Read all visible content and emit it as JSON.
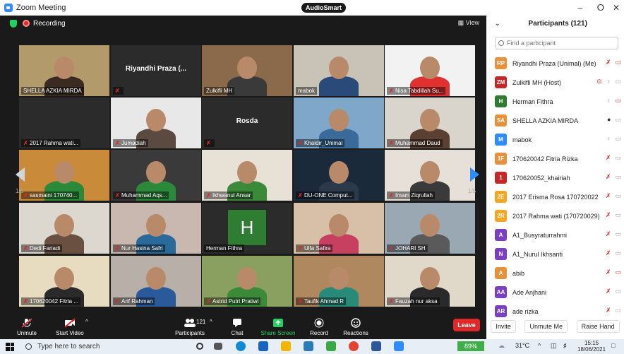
{
  "window": {
    "title": "Zoom Meeting",
    "brand": "AudioSmart",
    "minimize": "–",
    "maximize": "ⵔ",
    "close": "✕"
  },
  "meeting": {
    "recording_label": "Recording",
    "view_label": "View",
    "page_left": "1/5",
    "page_right": "1/5"
  },
  "tiles": [
    {
      "name": "SHELLA AZKIA MIRDA",
      "muted": false,
      "active": true,
      "kind": "video",
      "colors": [
        "#b29a6a",
        "#3a2a22"
      ]
    },
    {
      "name": "",
      "big": "Riyandhi Praza (...",
      "muted": true,
      "kind": "none"
    },
    {
      "name": "Zulkifli MH",
      "muted": false,
      "kind": "video",
      "colors": [
        "#8a6a4a",
        "#3a3a3a"
      ]
    },
    {
      "name": "mabok",
      "muted": false,
      "kind": "video",
      "colors": [
        "#c9c2b6",
        "#2a4a7a"
      ]
    },
    {
      "name": "Nisa Tabdillah Su...",
      "muted": true,
      "kind": "video",
      "colors": [
        "#f2f2f2",
        "#e03030"
      ]
    },
    {
      "name": "2017 Rahma wati...",
      "muted": true,
      "kind": "none"
    },
    {
      "name": "Jumadiah",
      "muted": true,
      "kind": "video",
      "colors": [
        "#e8e8e8",
        "#5a4a40"
      ]
    },
    {
      "name": "",
      "big": "Rosda",
      "muted": true,
      "kind": "none"
    },
    {
      "name": "Khaidir_Unimal",
      "muted": true,
      "kind": "video",
      "colors": [
        "#7fa7c9",
        "#3a6a9a"
      ]
    },
    {
      "name": "Muhammad Daud",
      "muted": true,
      "kind": "video",
      "colors": [
        "#d9d4cc",
        "#5a4030"
      ]
    },
    {
      "name": "sasmaini 170740...",
      "muted": true,
      "kind": "video",
      "colors": [
        "#c98a3a",
        "#2a8a3a"
      ]
    },
    {
      "name": "Muhammad Aqs...",
      "muted": true,
      "kind": "video",
      "colors": [
        "#3a3a3a",
        "#2a8a3a"
      ]
    },
    {
      "name": "Ikhwanul Ansar",
      "muted": true,
      "kind": "video",
      "colors": [
        "#e8e2d6",
        "#3a8a3a"
      ]
    },
    {
      "name": "DU-ONE Comput...",
      "muted": true,
      "kind": "video",
      "colors": [
        "#1a2a3a",
        "#2a3a4a"
      ]
    },
    {
      "name": "Imam Ziqrullah",
      "muted": true,
      "kind": "video",
      "colors": [
        "#e6e0d8",
        "#3a3a3a"
      ]
    },
    {
      "name": "Dedi Fariadi",
      "muted": true,
      "kind": "video",
      "colors": [
        "#dcd8d0",
        "#6a5040"
      ]
    },
    {
      "name": "Nur Hasina Safri",
      "muted": true,
      "kind": "video",
      "colors": [
        "#c8b8b0",
        "#2a6a9a"
      ]
    },
    {
      "name": "Herman Fithra",
      "muted": false,
      "kind": "avatar",
      "letter": "H"
    },
    {
      "name": "Ulfa Safira",
      "muted": true,
      "kind": "video",
      "colors": [
        "#d8c0a8",
        "#c84060"
      ]
    },
    {
      "name": "JOHARI SH",
      "muted": true,
      "kind": "video",
      "colors": [
        "#9aa8b4",
        "#5a5a5a"
      ]
    },
    {
      "name": "170620042 Fitria ...",
      "muted": true,
      "kind": "video",
      "colors": [
        "#e8dcc0",
        "#2a2a2a"
      ]
    },
    {
      "name": "Arif Rahman",
      "muted": true,
      "kind": "video",
      "colors": [
        "#b8b0a8",
        "#2a5a9a"
      ]
    },
    {
      "name": "Astrid Putri Pratiwi",
      "muted": true,
      "kind": "video",
      "colors": [
        "#8aa060",
        "#3a8a3a"
      ]
    },
    {
      "name": "Taufik Ahmad R",
      "muted": true,
      "kind": "video",
      "colors": [
        "#b08860",
        "#2a8a7a"
      ]
    },
    {
      "name": "Fauzah nur aksa",
      "muted": true,
      "kind": "video",
      "colors": [
        "#e0d8c8",
        "#2a2a2a"
      ]
    }
  ],
  "toolbar": {
    "unmute": "Unmute",
    "start_video": "Start Video",
    "participants": "Participants",
    "participants_count": "121",
    "chat": "Chat",
    "share_screen": "Share Screen",
    "record": "Record",
    "reactions": "Reactions",
    "leave": "Leave",
    "colors": {
      "share": "#23d160",
      "leave": "#e02828"
    }
  },
  "panel": {
    "title": "Participants (121)",
    "search_placeholder": "Find a participant",
    "participants": [
      {
        "initials": "RP",
        "color": "#e8913a",
        "name": "Riyandhi Praza (Unimal) (Me)",
        "icons": "mic-off vid-off"
      },
      {
        "initials": "ZM",
        "color": "#c62828",
        "name": "Zulkifli MH (Host)",
        "icons": "share mic vid"
      },
      {
        "initials": "H",
        "color": "#2e7d32",
        "name": "Herman Fithra",
        "icons": "mic vid-off"
      },
      {
        "initials": "SA",
        "color": "#e8913a",
        "name": "SHELLA AZKIA MIRDA",
        "icons": "mic-on vid"
      },
      {
        "initials": "M",
        "color": "#2d8cff",
        "name": "mabok",
        "icons": "mic vid"
      },
      {
        "initials": "1F",
        "color": "#e8913a",
        "name": "170620042 Fitria Rizka",
        "icons": "mic-off vid"
      },
      {
        "initials": "1",
        "color": "#c62828",
        "name": "170620052_khairiah",
        "icons": "mic-off vid"
      },
      {
        "initials": "2E",
        "color": "#f5a623",
        "name": "2017 Erisma Rosa 170720022",
        "icons": "mic-off vid"
      },
      {
        "initials": "2R",
        "color": "#f5a623",
        "name": "2017 Rahma wati (170720029)",
        "icons": "mic-off vid"
      },
      {
        "initials": "A",
        "color": "#7b3fc4",
        "name": "A1_Busyraturrahmi",
        "icons": "mic-off vid"
      },
      {
        "initials": "N",
        "color": "#7b3fc4",
        "name": "A1_Nurul Ikhsanti",
        "icons": "mic-off vid"
      },
      {
        "initials": "A",
        "color": "#e8913a",
        "name": "abib",
        "icons": "mic-off vid-off"
      },
      {
        "initials": "AA",
        "color": "#7b3fc4",
        "name": "Ade Anjhani",
        "icons": "mic-off vid"
      },
      {
        "initials": "AR",
        "color": "#7b3fc4",
        "name": "ade rizka",
        "icons": "mic-off vid"
      }
    ],
    "invite": "Invite",
    "unmute_me": "Unmute Me",
    "raise_hand": "Raise Hand"
  },
  "taskbar": {
    "search_placeholder": "Type here to search",
    "battery": "89%",
    "temperature": "31°C",
    "time": "15:15",
    "date": "18/06/2021"
  }
}
